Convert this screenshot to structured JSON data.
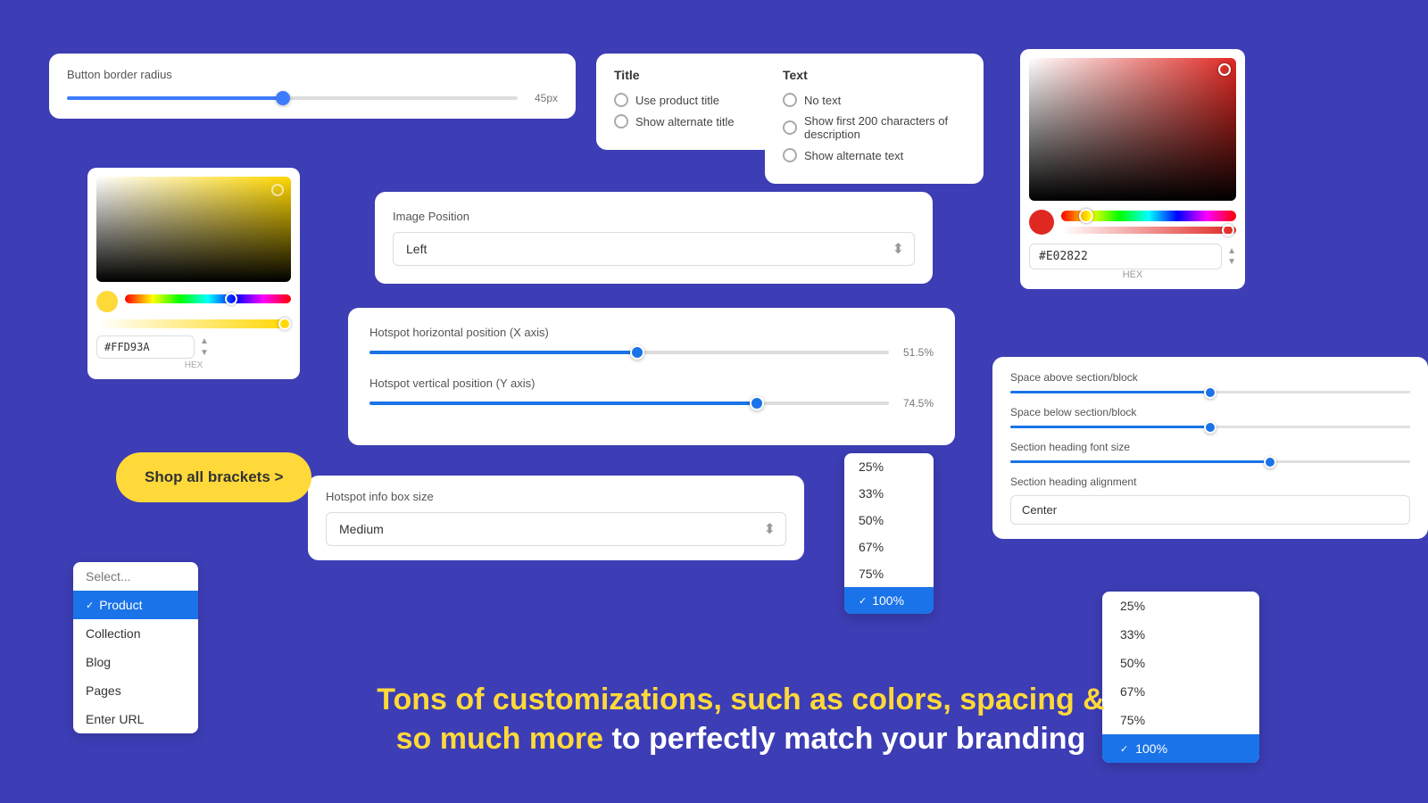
{
  "page": {
    "background_color": "#3d3db5"
  },
  "border_radius_card": {
    "label": "Button border radius",
    "value": "45px",
    "slider_percent": 48
  },
  "title_card": {
    "heading": "Title",
    "options": [
      "Use product title",
      "Show alternate title"
    ]
  },
  "text_card": {
    "heading": "Text",
    "options": [
      "No text",
      "Show first 200 characters of description",
      "Show alternate text"
    ]
  },
  "color_picker_right": {
    "hex_value": "#E02822",
    "hex_label": "HEX"
  },
  "color_picker_yellow": {
    "hex_value": "#FFD93A",
    "hex_label": "HEX"
  },
  "image_position_card": {
    "heading": "Image Position",
    "value": "Left"
  },
  "hotspot_position_card": {
    "x_label": "Hotspot horizontal position (X axis)",
    "x_value": "51.5%",
    "x_percent": 51.5,
    "y_label": "Hotspot vertical position (Y axis)",
    "y_value": "74.5%",
    "y_percent": 74.5
  },
  "hotspot_size_card": {
    "heading": "Hotspot info box size",
    "value": "Medium"
  },
  "shop_button": {
    "label": "Shop all brackets >"
  },
  "dropdown_menu": {
    "placeholder": "Select...",
    "items": [
      "Product",
      "Collection",
      "Blog",
      "Pages",
      "Enter URL"
    ],
    "selected": "Product"
  },
  "pct_dropdown_small": {
    "items": [
      "25%",
      "33%",
      "50%",
      "67%",
      "75%",
      "100%"
    ],
    "selected": "100%"
  },
  "spacing_card": {
    "labels": [
      "Space above section/block",
      "Space below section/block",
      "Section heading font size",
      "Section heading alignment"
    ],
    "heading_alignment_value": "Center",
    "slider_positions": [
      50,
      50,
      65
    ]
  },
  "pct_dropdown_large": {
    "items": [
      "25%",
      "33%",
      "50%",
      "67%",
      "75%",
      "100%"
    ],
    "selected": "100%"
  },
  "bottom_text": {
    "yellow_part": "Tons of customizations, such as colors, spacing &",
    "yellow_highlight": "so much more",
    "white_suffix": "to perfectly match your branding"
  }
}
